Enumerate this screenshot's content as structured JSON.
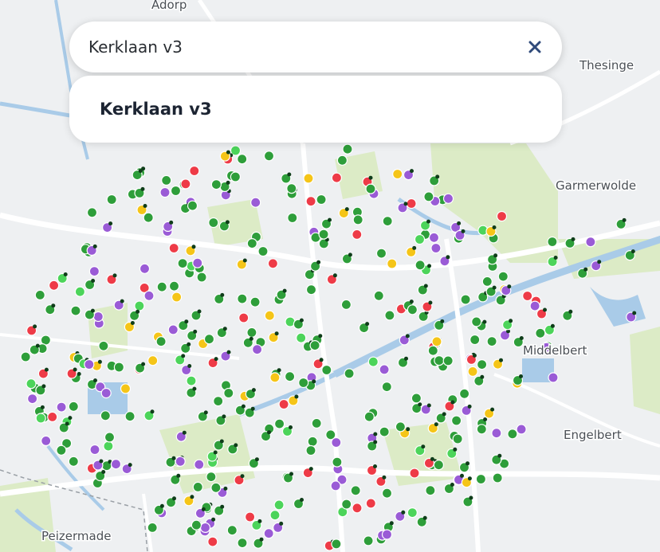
{
  "search": {
    "value": "Kerklaan v3"
  },
  "suggestions": [
    {
      "label": "Kerklaan v3"
    }
  ],
  "places": [
    "Adorp",
    "Thesinge",
    "Garmerwolde",
    "Middelbert",
    "Engelbert",
    "Peizermade"
  ],
  "marker_colors": {
    "green": "#2e9e3a",
    "light_green": "#4cd45a",
    "purple": "#9a5bd6",
    "red": "#ee3b47",
    "yellow": "#f5c518"
  },
  "map_colors": {
    "land": "#eef0f2",
    "park": "#dcebc6",
    "water": "#a9cbe8",
    "road": "#ffffff"
  },
  "icons": {
    "clear": "close-icon"
  }
}
